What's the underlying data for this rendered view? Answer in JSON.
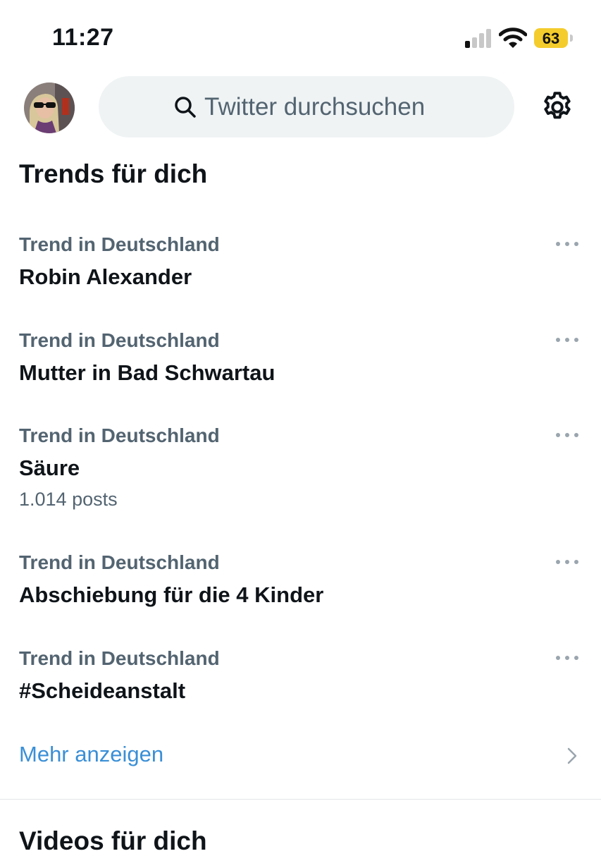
{
  "status_bar": {
    "time": "11:27",
    "battery_level": "63",
    "battery_color": "#f4cc2c",
    "signal_bars_active": 1,
    "signal_bars_total": 4,
    "wifi_icon": "wifi-icon"
  },
  "header": {
    "avatar_icon": "profile-avatar",
    "search_placeholder": "Twitter durchsuchen",
    "settings_icon": "gear-icon"
  },
  "trends_section": {
    "title": "Trends für dich",
    "items": [
      {
        "context": "Trend in Deutschland",
        "name": "Robin Alexander",
        "count": ""
      },
      {
        "context": "Trend in Deutschland",
        "name": "Mutter in Bad Schwartau",
        "count": ""
      },
      {
        "context": "Trend in Deutschland",
        "name": "Säure",
        "count": "1.014 posts"
      },
      {
        "context": "Trend in Deutschland",
        "name": "Abschiebung für die 4 Kinder",
        "count": ""
      },
      {
        "context": "Trend in Deutschland",
        "name": "#Scheideanstalt",
        "count": ""
      }
    ],
    "show_more_label": "Mehr anzeigen"
  },
  "videos_section": {
    "title": "Videos für dich"
  },
  "colors": {
    "accent": "#3a8fd6",
    "secondary_text": "#536471",
    "primary_text": "#0f1419",
    "search_background": "#eff3f4"
  }
}
